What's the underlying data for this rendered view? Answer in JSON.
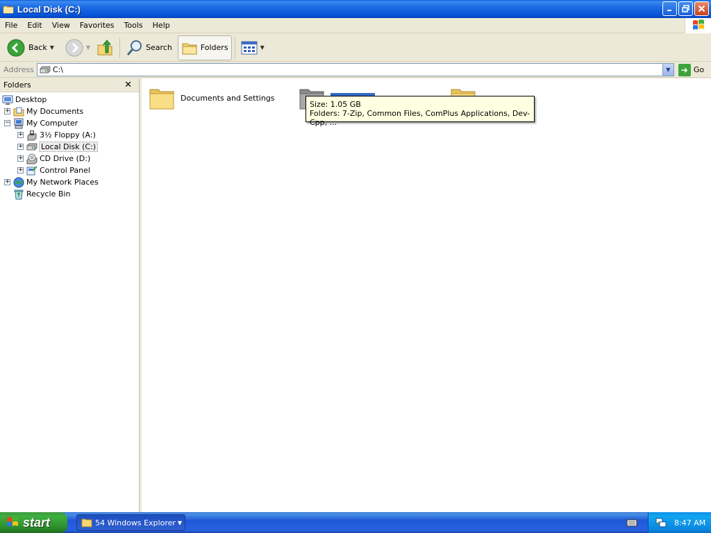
{
  "window": {
    "title": "Local Disk (C:)"
  },
  "menu": [
    "File",
    "Edit",
    "View",
    "Favorites",
    "Tools",
    "Help"
  ],
  "toolbar": {
    "back_label": "Back",
    "search_label": "Search",
    "folders_label": "Folders"
  },
  "address": {
    "label": "Address",
    "value": "C:\\",
    "go_label": "Go"
  },
  "folders_pane": {
    "title": "Folders",
    "tree": [
      {
        "label": "Desktop",
        "icon": "desktop-icon",
        "expander": ""
      },
      {
        "label": "My Documents",
        "icon": "my-documents-icon",
        "expander": "+"
      },
      {
        "label": "My Computer",
        "icon": "my-computer-icon",
        "expander": "−"
      },
      {
        "label": "3½ Floppy (A:)",
        "icon": "floppy-drive-icon",
        "expander": "+"
      },
      {
        "label": "Local Disk (C:)",
        "icon": "hard-disk-icon",
        "expander": "+",
        "selected": true
      },
      {
        "label": "CD Drive (D:)",
        "icon": "cd-drive-icon",
        "expander": "+"
      },
      {
        "label": "Control Panel",
        "icon": "control-panel-icon",
        "expander": "+"
      },
      {
        "label": "My Network Places",
        "icon": "network-places-icon",
        "expander": "+"
      },
      {
        "label": "Recycle Bin",
        "icon": "recycle-bin-icon",
        "expander": ""
      }
    ]
  },
  "content": {
    "items": [
      {
        "label": "Documents and Settings",
        "icon": "folder-icon"
      },
      {
        "label": "",
        "icon": "folder-icon",
        "selected": true
      },
      {
        "label": "",
        "icon": "folder-icon"
      }
    ],
    "tooltip": {
      "line1": "Size: 1.05 GB",
      "line2": "Folders: 7-Zip, Common Files, ComPlus Applications, Dev-Cpp, ..."
    }
  },
  "taskbar": {
    "start_label": "start",
    "task_label": "54 Windows Explorer",
    "clock": "8:47 AM"
  },
  "colors": {
    "titlebar": "#0551D6",
    "selection": "#316AC5",
    "tooltip_bg": "#FFFFE1",
    "start_green": "#3FAF3F"
  }
}
